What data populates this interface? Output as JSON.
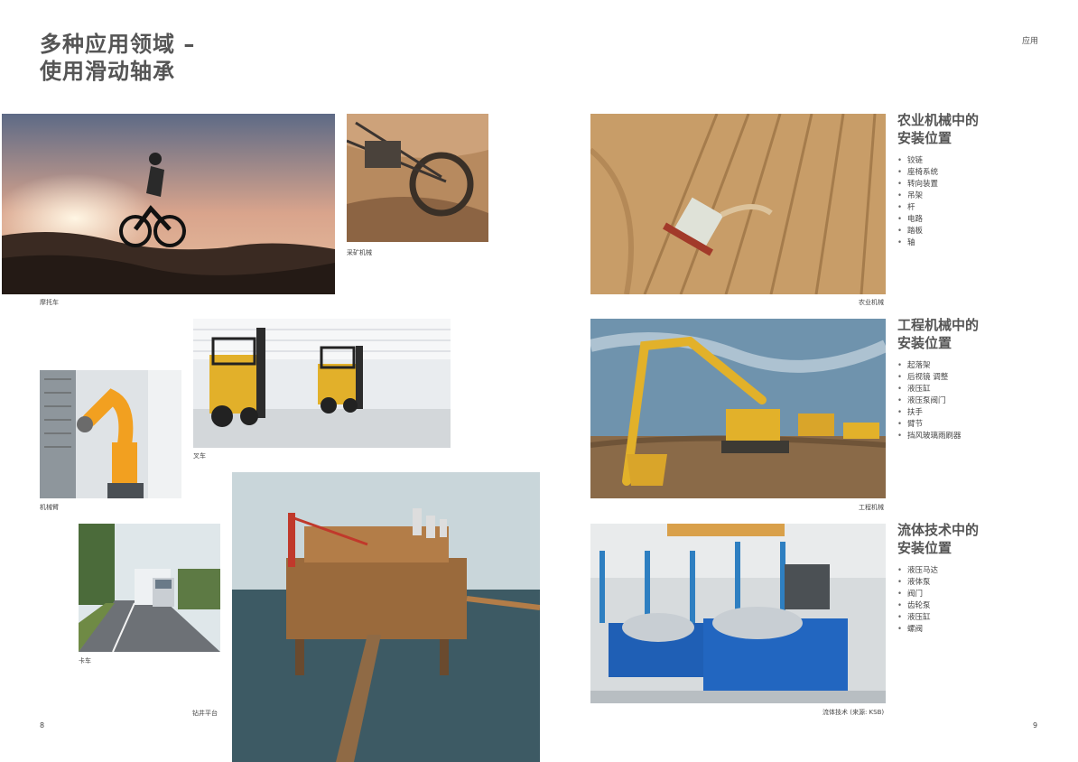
{
  "title": {
    "line1": "多种应用领域 –",
    "line2": "使用滑动轴承"
  },
  "section_label": "应用",
  "page_numbers": {
    "left": "8",
    "right": "9"
  },
  "captions": {
    "motorcycle": "摩托车",
    "mining": "采矿机械",
    "forklift": "叉车",
    "robot_arm": "机械臂",
    "truck": "卡车",
    "oil_rig": "钻井平台",
    "agriculture": "农业机械",
    "construction": "工程机械",
    "fluid": "流体技术 (来源: KSB)"
  },
  "panels": [
    {
      "title_line1": "农业机械中的",
      "title_line2": "安装位置",
      "items": [
        "铰链",
        "座椅系统",
        "转向装置",
        "吊架",
        "杆",
        "电路",
        "踏板",
        "轴"
      ]
    },
    {
      "title_line1": "工程机械中的",
      "title_line2": "安装位置",
      "items": [
        "起落架",
        "后视镜 调整",
        "液压缸",
        "液压泵阀门",
        "扶手",
        "臂节",
        "挡风玻璃雨刷器"
      ]
    },
    {
      "title_line1": "流体技术中的",
      "title_line2": "安装位置",
      "items": [
        "液压马达",
        "液体泵",
        "阀门",
        "齿轮泵",
        "液压缸",
        "螺阀"
      ]
    }
  ],
  "icons": {
    "photo-placeholders": "inline-svg-scenes"
  }
}
